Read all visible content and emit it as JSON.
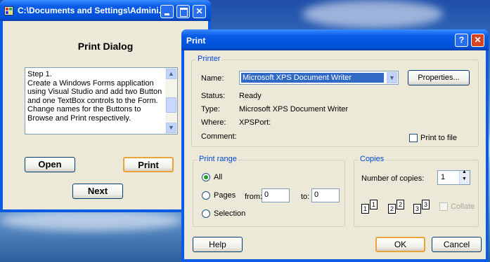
{
  "main_window": {
    "title": "C:\\Documents and Settings\\Admini...",
    "heading": "Print Dialog",
    "textbox_content": "Step 1.\nCreate a Windows Forms application using Visual Studio and add two Button and one TextBox controls to the Form. Change names for the Buttons to Browse and Print respectively.",
    "open_label": "Open",
    "print_label": "Print",
    "next_label": "Next"
  },
  "print_dialog": {
    "title": "Print",
    "help_title_icon": "?",
    "printer": {
      "group_label": "Printer",
      "name_label": "Name:",
      "name_value": "Microsoft XPS Document Writer",
      "properties_label": "Properties...",
      "status_label": "Status:",
      "status_value": "Ready",
      "type_label": "Type:",
      "type_value": "Microsoft XPS Document Writer",
      "where_label": "Where:",
      "where_value": "XPSPort:",
      "comment_label": "Comment:",
      "print_to_file_label": "Print to file"
    },
    "print_range": {
      "group_label": "Print range",
      "all_label": "All",
      "pages_label": "Pages",
      "from_label": "from:",
      "from_value": "0",
      "to_label": "to:",
      "to_value": "0",
      "selection_label": "Selection",
      "selected": "All"
    },
    "copies": {
      "group_label": "Copies",
      "number_label": "Number of copies:",
      "number_value": "1",
      "collate_label": "Collate",
      "page_numbers": [
        "1",
        "1",
        "2",
        "2",
        "3",
        "3"
      ]
    },
    "help_label": "Help",
    "ok_label": "OK",
    "cancel_label": "Cancel"
  },
  "colors": {
    "titlebar_blue": "#0a5ce6",
    "close_red": "#d7451f",
    "group_label_blue": "#0046d5",
    "window_face": "#ece9d8"
  }
}
